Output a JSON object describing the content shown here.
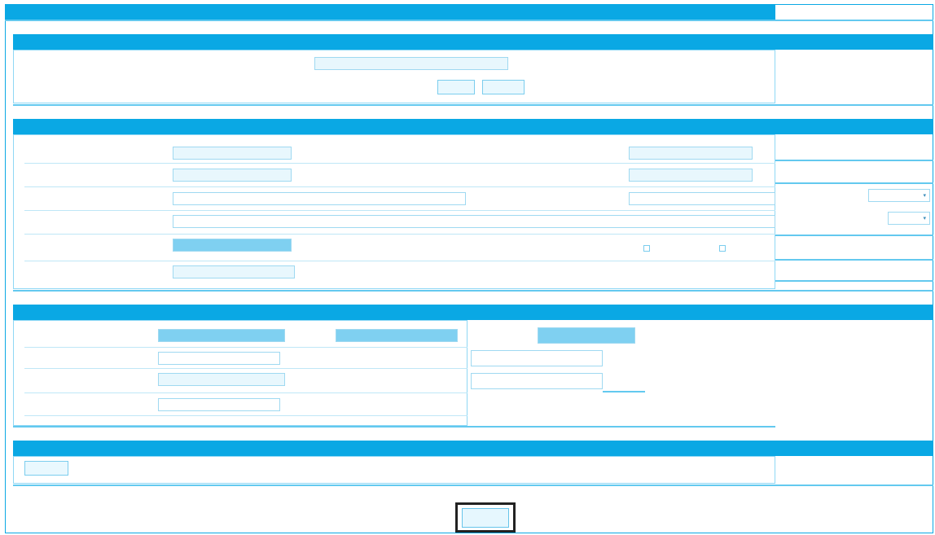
{
  "window": {
    "title": ""
  },
  "search": {
    "header": "",
    "label": "",
    "value": "",
    "search_button": "",
    "reset_button": ""
  },
  "info": {
    "header": "",
    "left_labels": [
      "",
      "",
      "",
      "",
      "",
      ""
    ],
    "left_values": [
      "",
      "",
      "",
      "",
      "",
      ""
    ],
    "right_labels": [
      "",
      "",
      "",
      ""
    ],
    "right_values": [
      "",
      "",
      "",
      ""
    ],
    "radio_options": [
      "",
      ""
    ]
  },
  "costs": {
    "header": "",
    "left_labels": [
      "",
      "",
      "",
      ""
    ],
    "left_values": [
      "",
      "",
      "",
      ""
    ],
    "mid_labels": [
      "",
      "",
      ""
    ],
    "mid_values": [
      "",
      "",
      ""
    ],
    "total_label": "",
    "totals": [
      "",
      "",
      ""
    ]
  },
  "notes": {
    "header": "",
    "button": ""
  },
  "submit_label": "",
  "colors": {
    "accent": "#0aa8e4",
    "field_bg": "#e8f7fd",
    "selected": "#7fd0f1"
  }
}
